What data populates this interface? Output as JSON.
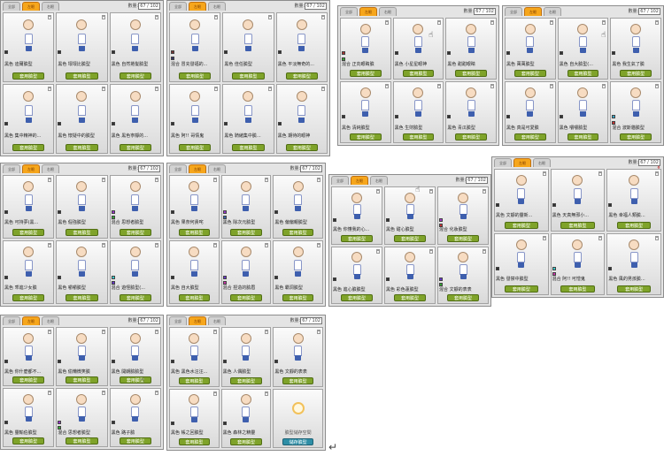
{
  "panel_defaults": {
    "tabs": [
      "全部",
      "左眼",
      "右眼"
    ],
    "counter_label": "數量:",
    "counter_value": "67 / 102",
    "button_label": "套用臉型"
  },
  "panels": [
    {
      "cells": [
        {
          "name": "黑色 迪爾臉型"
        },
        {
          "name": "黑色 壞壞比臉型"
        },
        {
          "name": "黑色 自然捲髮臉型"
        },
        {
          "name": "黑色 集中精神的..."
        },
        {
          "name": "黑色 懷疑中的臉型"
        },
        {
          "name": "黑色 黑色寧靜的..."
        }
      ]
    },
    {
      "cells": [
        {
          "name": "混合 冒充發福的..."
        },
        {
          "name": "黑色 佳任臉型"
        },
        {
          "name": "黑色 平淡無奇的..."
        },
        {
          "name": "黑色 阿!! 哥情鬼"
        },
        {
          "name": "黑色 騎緒集中臉..."
        },
        {
          "name": "黑色 期待的眼神"
        }
      ]
    },
    {
      "cells": [
        {
          "name": "混合 正向眼睛臉"
        },
        {
          "name": "黑色 小星星眼神"
        },
        {
          "name": "黑色 甜甜眼睛"
        },
        {
          "name": "黑色 清純臉型"
        },
        {
          "name": "黑色 生財臉型"
        },
        {
          "name": "黑色 青瓜臉型"
        }
      ]
    },
    {
      "cells": [
        {
          "name": "黑色 萬萬臉型"
        },
        {
          "name": "黑色 自大臉型(..."
        },
        {
          "name": "黑色 我生氣了臉"
        },
        {
          "name": "黑色 真是可愛臉"
        },
        {
          "name": "黑色 嚼嚼臉型"
        },
        {
          "name": "混合 波斯貓臉型"
        }
      ]
    },
    {
      "cells": [
        {
          "name": "黑色 可持夢(黑..."
        },
        {
          "name": "黑色 倔強臉型"
        },
        {
          "name": "混合 思想者臉型"
        },
        {
          "name": "黑色 乖進少女臉"
        },
        {
          "name": "黑色 嚼嚼臉型"
        },
        {
          "name": "混合 遊怪臉型(..."
        }
      ]
    },
    {
      "cells": [
        {
          "name": "黑色 果奈何貴咤"
        },
        {
          "name": "黑色 除次元臉型"
        },
        {
          "name": "黑色 偏偏親臉型"
        },
        {
          "name": "黑色 自大臉型"
        },
        {
          "name": "混合 捏造的臉眉"
        },
        {
          "name": "黑色 霸洞臉型"
        }
      ]
    },
    {
      "cells": [
        {
          "name": "黑色 你懂我的心..."
        },
        {
          "name": "黑色 甜心臉型"
        },
        {
          "name": "混合 化妝臉型"
        },
        {
          "name": "黑色 進心臉臉型"
        },
        {
          "name": "黑色 彩色蓮臉型"
        },
        {
          "name": "混合 文靜的表表"
        }
      ]
    },
    {
      "cells": [
        {
          "name": "黑色 文靜的靈新..."
        },
        {
          "name": "黑色 天真無邪小..."
        },
        {
          "name": "黑色 幸福人類臉..."
        },
        {
          "name": "黑色 發禁中臉型"
        },
        {
          "name": "混合 阿!! 可憎鬼"
        },
        {
          "name": "黑色 風的男孩臉..."
        }
      ]
    },
    {
      "cells": [
        {
          "name": "黑色 你什麼都不..."
        },
        {
          "name": "黑色 偷懶微笑臉"
        },
        {
          "name": "黑色 開朗臉臉型"
        },
        {
          "name": "黑色 靈輸伯臉型"
        },
        {
          "name": "混合 思想者臉型"
        },
        {
          "name": "黑色 路子臉"
        }
      ]
    },
    {
      "cells": [
        {
          "name": "黑色 黑色水汪汪..."
        },
        {
          "name": "黑色 人偶臉型"
        },
        {
          "name": "黑色 文靜的表表"
        },
        {
          "name": "黑色 帳之回臉型"
        },
        {
          "name": "黑色 森林之精靈"
        },
        {
          "name": "",
          "empty": true,
          "caption": "臉型儲存空間",
          "button": "儲存臉型"
        }
      ]
    }
  ],
  "icons": {
    "trash": "trash-icon",
    "hand_cursor": "hand-cursor-icon",
    "enter_arrow": "return-arrow-icon",
    "scroll_arrows": "up-down-arrow-icon"
  },
  "colors": {
    "apply_button": "#7fa32a",
    "save_button": "#2e8ea6",
    "active_tab": "#f6a61c"
  }
}
